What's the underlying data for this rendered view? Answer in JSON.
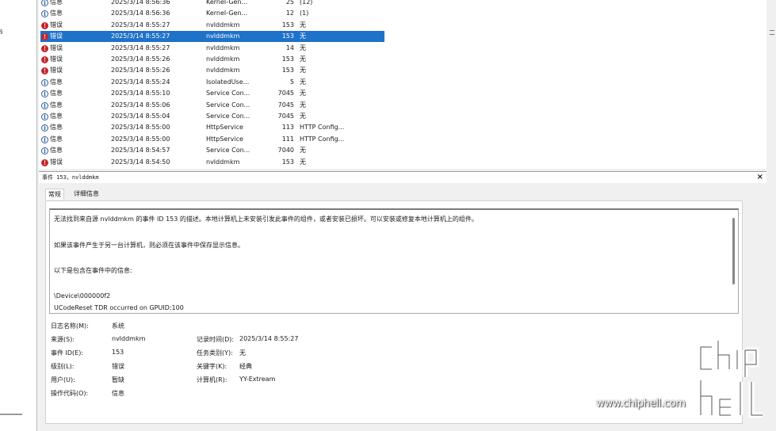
{
  "left_pane": {
    "fragment": "§"
  },
  "event_rows": [
    {
      "level_icon": "info-icon",
      "level": "信息",
      "datetime": "2025/3/14 8:56:36",
      "source": "Kernel-Gen...",
      "event_id": "25",
      "task": "(12)"
    },
    {
      "level_icon": "info-icon",
      "level": "信息",
      "datetime": "2025/3/14 8:56:36",
      "source": "Kernel-Gen...",
      "event_id": "12",
      "task": "(1)"
    },
    {
      "level_icon": "error-icon",
      "level": "错误",
      "datetime": "2025/3/14 8:55:27",
      "source": "nvlddmkm",
      "event_id": "153",
      "task": "无"
    },
    {
      "level_icon": "error-icon",
      "level": "错误",
      "datetime": "2025/3/14 8:55:27",
      "source": "nvlddmkm",
      "event_id": "153",
      "task": "无",
      "selected": true
    },
    {
      "level_icon": "error-icon",
      "level": "错误",
      "datetime": "2025/3/14 8:55:27",
      "source": "nvlddmkm",
      "event_id": "14",
      "task": "无"
    },
    {
      "level_icon": "error-icon",
      "level": "错误",
      "datetime": "2025/3/14 8:55:26",
      "source": "nvlddmkm",
      "event_id": "153",
      "task": "无"
    },
    {
      "level_icon": "error-icon",
      "level": "错误",
      "datetime": "2025/3/14 8:55:26",
      "source": "nvlddmkm",
      "event_id": "153",
      "task": "无"
    },
    {
      "level_icon": "info-icon",
      "level": "信息",
      "datetime": "2025/3/14 8:55:24",
      "source": "IsolatedUse...",
      "event_id": "5",
      "task": "无"
    },
    {
      "level_icon": "info-icon",
      "level": "信息",
      "datetime": "2025/3/14 8:55:10",
      "source": "Service Con...",
      "event_id": "7045",
      "task": "无"
    },
    {
      "level_icon": "info-icon",
      "level": "信息",
      "datetime": "2025/3/14 8:55:06",
      "source": "Service Con...",
      "event_id": "7045",
      "task": "无"
    },
    {
      "level_icon": "info-icon",
      "level": "信息",
      "datetime": "2025/3/14 8:55:04",
      "source": "Service Con...",
      "event_id": "7045",
      "task": "无"
    },
    {
      "level_icon": "info-icon",
      "level": "信息",
      "datetime": "2025/3/14 8:55:00",
      "source": "HttpService",
      "event_id": "113",
      "task": "HTTP Config..."
    },
    {
      "level_icon": "info-icon",
      "level": "信息",
      "datetime": "2025/3/14 8:55:00",
      "source": "HttpService",
      "event_id": "111",
      "task": "HTTP Config..."
    },
    {
      "level_icon": "info-icon",
      "level": "信息",
      "datetime": "2025/3/14 8:54:57",
      "source": "Service Con...",
      "event_id": "7040",
      "task": "无"
    },
    {
      "level_icon": "error-icon",
      "level": "错误",
      "datetime": "2025/3/14 8:54:50",
      "source": "nvlddmkm",
      "event_id": "153",
      "task": "无"
    }
  ],
  "detail": {
    "title": "事件 153，nvlddmkm",
    "close": "×",
    "tabs": [
      "常规",
      "详细信息"
    ],
    "description": [
      "无法找到来自源 nvlddmkm 的事件 ID 153 的描述。本地计算机上未安装引发此事件的组件，或者安装已损坏。可以安装或修复本地计算机上的组件。",
      "如果该事件产生于另一台计算机，则必须在该事件中保存显示信息。",
      "以下是包含在事件中的信息:",
      "\\Device\\000000f2",
      "UCodeReset TDR occurred on GPUID:100"
    ],
    "properties": {
      "log_name_label": "日志名称(M):",
      "log_name": "系统",
      "source_label": "来源(S):",
      "source": "nvlddmkm",
      "logged_label": "记录时间(D):",
      "logged": "2025/3/14 8:55:27",
      "event_id_label": "事件 ID(E):",
      "event_id": "153",
      "task_label": "任务类别(Y):",
      "task": "无",
      "level_label": "级别(L):",
      "level": "错误",
      "keywords_label": "关键字(K):",
      "keywords": "经典",
      "user_label": "用户(U):",
      "user": "暂缺",
      "computer_label": "计算机(R):",
      "computer": "YY-Extream",
      "opcode_label": "操作代码(O):",
      "opcode": "信息"
    }
  },
  "watermark": {
    "text": "www.chiphell.com",
    "logo_text": "chip hell"
  },
  "colors": {
    "selection": "#1e72c8",
    "error": "#c4262e",
    "info": "#2b5c9b"
  }
}
